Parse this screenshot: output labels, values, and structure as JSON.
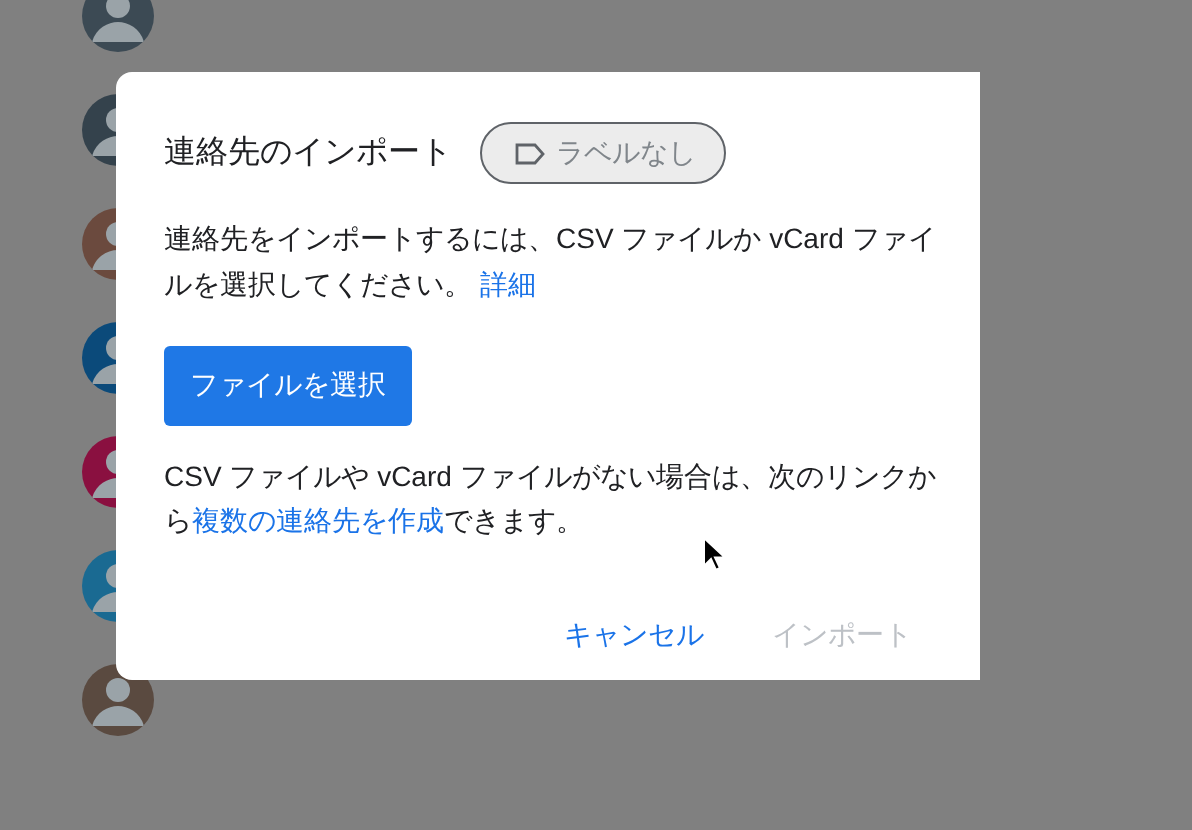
{
  "contacts": [
    {
      "color": "#3c4a54"
    },
    {
      "color": "#34424c"
    },
    {
      "color": "#6b4a3e"
    },
    {
      "color": "#0b4a7a"
    },
    {
      "color": "#8a1040"
    },
    {
      "color": "#1a6a92"
    },
    {
      "color": "#5a4a40"
    }
  ],
  "dialog": {
    "title": "連絡先のインポート",
    "label_chip": "ラベルなし",
    "intro": {
      "text": "連絡先をインポートするには、CSV ファイルか vCard ファイルを選択してください。",
      "link": "詳細"
    },
    "select_button": "ファイルを選択",
    "note": {
      "before": "CSV ファイルや vCard ファイルがない場合は、次のリンクから",
      "link": "複数の連絡先を作成",
      "after": "できます。"
    },
    "buttons": [
      {
        "label": "キャンセル",
        "disabled": false
      },
      {
        "label": "インポート",
        "disabled": true
      }
    ]
  }
}
